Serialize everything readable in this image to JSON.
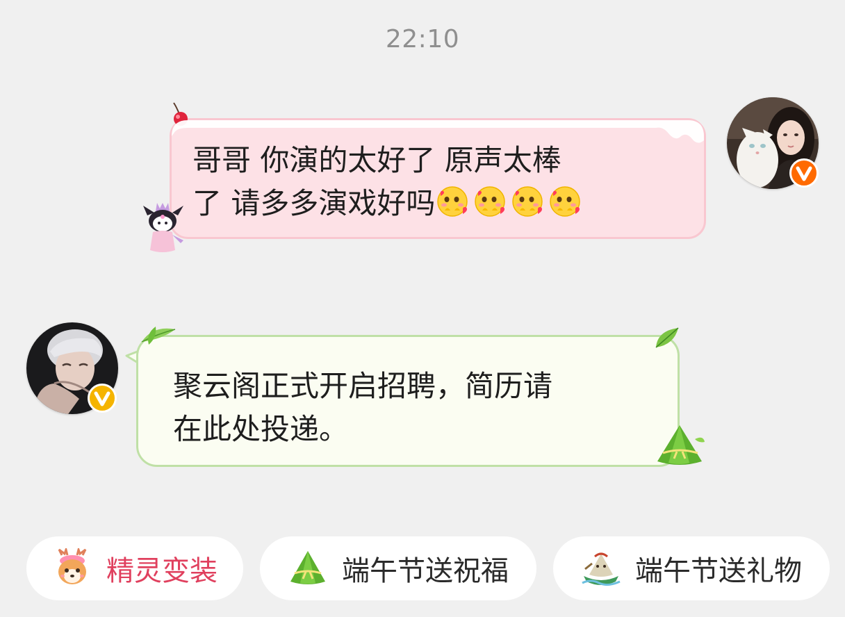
{
  "status": {
    "time": "22:10"
  },
  "messages": [
    {
      "direction": "outgoing",
      "line1": "哥哥 你演的太好了 原声太棒",
      "line2": "了 请多多演戏好吗",
      "emojis": [
        "shy-blush-emoji",
        "shy-blush-emoji",
        "shy-blush-emoji",
        "shy-blush-emoji"
      ],
      "bubble_color": "#fde1e6",
      "bubble_border": "#f9c7d0"
    },
    {
      "direction": "incoming",
      "line1": "聚云阁正式开启招聘，简历请",
      "line2": "在此处投递。",
      "bubble_color": "#fbfdf2",
      "bubble_border": "#bfe0a6"
    }
  ],
  "avatars": {
    "outgoing": {
      "icon": "girl-with-white-cat-avatar",
      "badge": "orange-v-badge",
      "badge_color": "#ff6a00"
    },
    "incoming": {
      "icon": "white-hair-boy-avatar",
      "badge": "gold-v-badge",
      "badge_color": "#f5b400"
    }
  },
  "quick_actions": [
    {
      "label": "精灵变装",
      "icon": "deer-sprite-icon",
      "color": "#e0405e"
    },
    {
      "label": "端午节送祝福",
      "icon": "zongzi-icon",
      "color": "#2a2a2a"
    },
    {
      "label": "端午节送礼物",
      "icon": "dragon-boat-gift-icon",
      "color": "#2a2a2a"
    }
  ]
}
